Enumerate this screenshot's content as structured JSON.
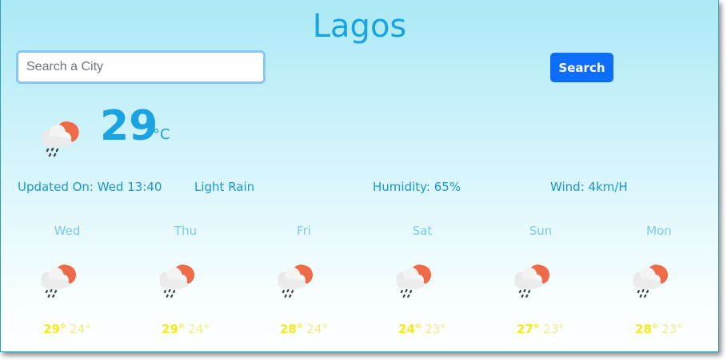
{
  "city": "Lagos",
  "search": {
    "placeholder": "Search a City",
    "value": "",
    "button_label": "Search"
  },
  "current": {
    "temperature": "29",
    "unit": "°C",
    "icon": "partly-cloudy-rain-icon",
    "updated_on": "Updated On: Wed 13:40",
    "condition": "Light Rain",
    "humidity": "Humidity: 65%",
    "wind": "Wind: 4km/H"
  },
  "forecast": [
    {
      "day": "Wed",
      "high": "29°",
      "low": "24°",
      "icon": "partly-cloudy-rain-icon"
    },
    {
      "day": "Thu",
      "high": "29°",
      "low": "24°",
      "icon": "partly-cloudy-rain-icon"
    },
    {
      "day": "Fri",
      "high": "28°",
      "low": "24°",
      "icon": "partly-cloudy-rain-icon"
    },
    {
      "day": "Sat",
      "high": "24°",
      "low": "23°",
      "icon": "partly-cloudy-rain-icon"
    },
    {
      "day": "Sun",
      "high": "27°",
      "low": "23°",
      "icon": "partly-cloudy-rain-icon"
    },
    {
      "day": "Mon",
      "high": "28°",
      "low": "23°",
      "icon": "partly-cloudy-rain-icon"
    }
  ],
  "colors": {
    "accent": "#1aa3e0",
    "button": "#0d6efd",
    "high_temp": "#f5ea14",
    "low_temp": "#f2ec80"
  }
}
